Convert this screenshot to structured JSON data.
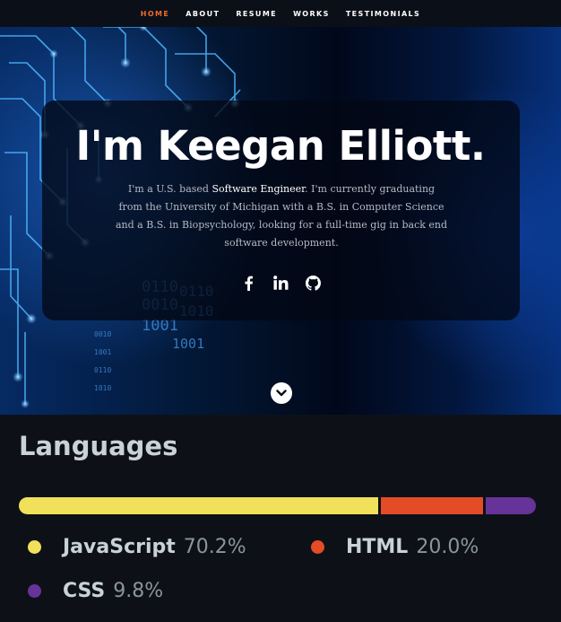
{
  "nav": {
    "items": [
      {
        "label": "HOME",
        "active": true
      },
      {
        "label": "ABOUT"
      },
      {
        "label": "RESUME"
      },
      {
        "label": "WORKS"
      },
      {
        "label": "TESTIMONIALS"
      }
    ]
  },
  "hero": {
    "title": "I'm Keegan Elliott.",
    "bio_prefix": "I'm a U.S. based ",
    "bio_highlight": "Software Engineer",
    "bio_suffix": ". I'm currently graduating from the University of Michigan with a B.S. in Computer Science and a B.S. in Biopsychology, looking for a full-time gig in back end software development.",
    "socials": [
      {
        "icon": "facebook-icon"
      },
      {
        "icon": "linkedin-icon"
      },
      {
        "icon": "github-icon"
      }
    ],
    "scroll_icon": "chevron-down-icon",
    "background_binary": [
      "0110",
      "0010",
      "1001",
      "0110",
      "1010",
      "1001",
      "0010",
      "1001",
      "0110",
      "1010"
    ]
  },
  "languages": {
    "title": "Languages",
    "items": [
      {
        "name": "JavaScript",
        "percent_label": "70.2%",
        "percent": 70.2,
        "color": "#f1e05a"
      },
      {
        "name": "HTML",
        "percent_label": "20.0%",
        "percent": 20.0,
        "color": "#e34c26"
      },
      {
        "name": "CSS",
        "percent_label": "9.8%",
        "percent": 9.8,
        "color": "#663399"
      }
    ]
  },
  "colors": {
    "accent": "#f06a2c",
    "hero_card": "#020814",
    "languages_bg": "#0d1117"
  }
}
